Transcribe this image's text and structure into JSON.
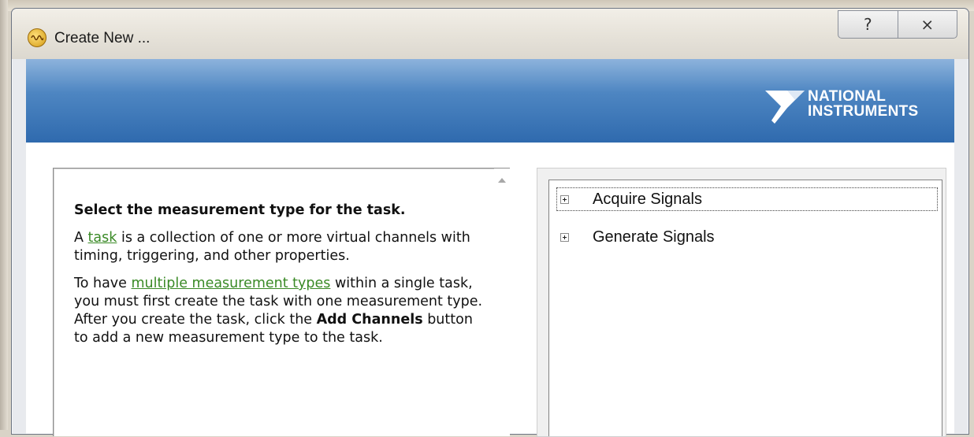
{
  "window": {
    "title": "Create New ...",
    "help_glyph": "?",
    "close_glyph": "⨯"
  },
  "banner": {
    "logo_line1": "NATIONAL",
    "logo_line2": "INSTRUMENTS"
  },
  "help": {
    "heading": "Select the measurement type for the task.",
    "p1_prefix": "A ",
    "p1_link": "task",
    "p1_suffix": " is a collection of one or more virtual channels with timing, triggering, and other properties.",
    "p2_prefix": "To have ",
    "p2_link": "multiple measurement types",
    "p2_mid": " within a single task, you must first create the task with one measurement type. After you create the task, click the ",
    "p2_bold": "Add Channels",
    "p2_suffix": " button to add a new measurement type to the task."
  },
  "tree": {
    "items": [
      {
        "label": "Acquire Signals"
      },
      {
        "label": "Generate Signals"
      }
    ]
  },
  "colors": {
    "banner_top": "#8db3dc",
    "banner_bottom": "#2f6aae",
    "link": "#3a8a26"
  }
}
